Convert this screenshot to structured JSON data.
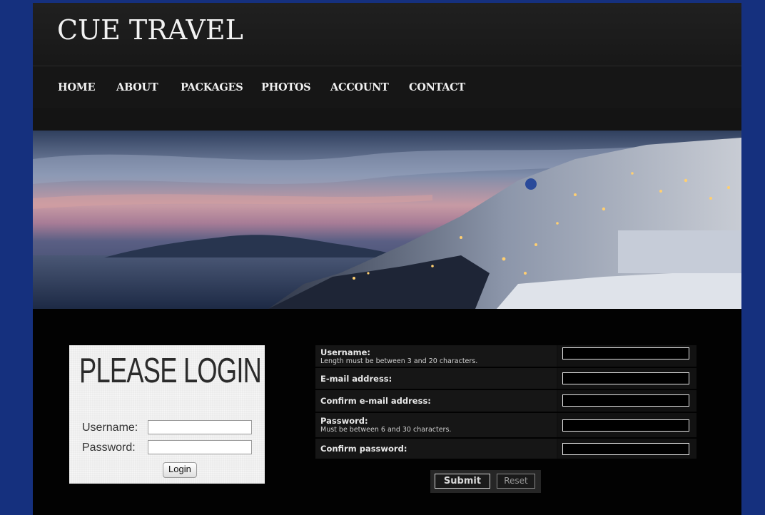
{
  "site": {
    "title": "CUE TRAVEL"
  },
  "nav": {
    "items": [
      {
        "label": "HOME"
      },
      {
        "label": "ABOUT"
      },
      {
        "label": "PACKAGES"
      },
      {
        "label": "PHOTOS"
      },
      {
        "label": "ACCOUNT"
      },
      {
        "label": "CONTACT"
      }
    ]
  },
  "banner": {
    "image": "sunset coastal village hillside photo"
  },
  "login": {
    "title": "PLEASE LOGIN",
    "username_label": "Username:",
    "password_label": "Password:",
    "username_value": "",
    "password_value": "",
    "button_label": "Login"
  },
  "register": {
    "fields": [
      {
        "label": "Username:",
        "note": "Length must be between 3 and 20 characters.",
        "value": ""
      },
      {
        "label": "E-mail address:",
        "note": "",
        "value": ""
      },
      {
        "label": "Confirm e-mail address:",
        "note": "",
        "value": ""
      },
      {
        "label": "Password:",
        "note": "Must be between 6 and 30 characters.",
        "value": ""
      },
      {
        "label": "Confirm password:",
        "note": "",
        "value": ""
      }
    ],
    "submit_label": "Submit",
    "reset_label": "Reset"
  },
  "colors": {
    "outer_background": "#15307e",
    "page_background": "#020202",
    "nav_text": "#f0f0f0"
  }
}
